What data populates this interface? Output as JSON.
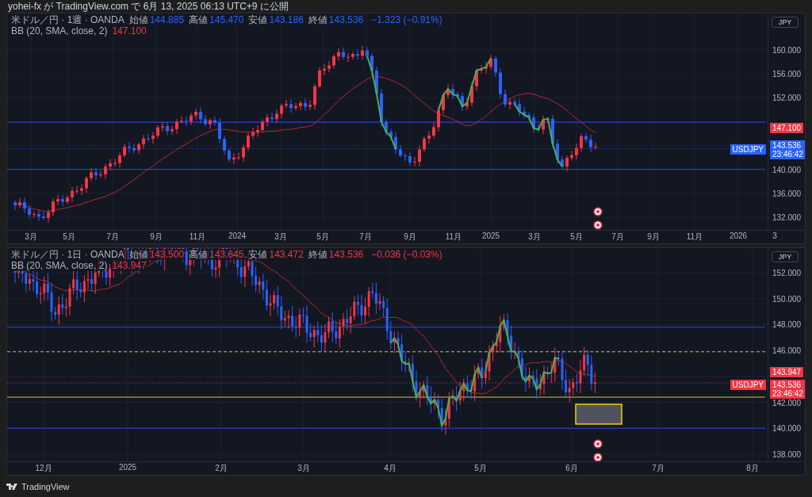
{
  "header": {
    "text": "yohei-fx が TradingView.com で 6月 13, 2025 06:13 UTC+9 に公開"
  },
  "panels": [
    {
      "currency": "JPY",
      "symbol": "米ドル／円 · 1週 · OANDA",
      "up_bar": false,
      "ohlc": [
        {
          "label": "始値",
          "value": "144.885"
        },
        {
          "label": "高値",
          "value": "145.470"
        },
        {
          "label": "安値",
          "value": "143.186"
        },
        {
          "label": "終値",
          "value": "143.536"
        }
      ],
      "change": "−1.323 (−0.91%)",
      "bb": {
        "label": "BB (20, SMA, close, 2)",
        "value": "147.100"
      },
      "price_ticks": [
        "160.000",
        "156.000",
        "152.000",
        "140.000",
        "136.000",
        "132.000"
      ],
      "price_labels": [
        {
          "kind": "price",
          "text": "147.100",
          "color": "#f23645"
        },
        {
          "kind": "symbol",
          "text": "USDJPY",
          "color": "#2962ff"
        },
        {
          "kind": "price",
          "text": "143.536",
          "sub": "23:46:42",
          "color": "#2962ff"
        }
      ],
      "time_ticks": [
        "3月",
        "5月",
        "7月",
        "9月",
        "11月",
        "2024",
        "3月",
        "5月",
        "7月",
        "9月",
        "11月",
        "2025",
        "3月",
        "5月",
        "7月",
        "9月",
        "11月",
        "2026",
        "3"
      ]
    },
    {
      "currency": "JPY",
      "symbol": "米ドル／円 · 1日 · OANDA",
      "up_bar": true,
      "ohlc": [
        {
          "label": "始値",
          "value": "143.500"
        },
        {
          "label": "高値",
          "value": "143.645"
        },
        {
          "label": "安値",
          "value": "143.472"
        },
        {
          "label": "終値",
          "value": "143.536"
        }
      ],
      "change": "−0.036 (−0.03%)",
      "bb": {
        "label": "BB (20, SMA, close, 2)",
        "value": "143.947"
      },
      "price_ticks": [
        "152.000",
        "150.000",
        "148.000",
        "146.000",
        "142.000",
        "140.000",
        "138.000"
      ],
      "price_labels": [
        {
          "kind": "price",
          "text": "143.947",
          "color": "#f23645"
        },
        {
          "kind": "symbol",
          "text": "USDJPY",
          "color": "#f23645"
        },
        {
          "kind": "price",
          "text": "143.536",
          "sub": "23:46:42",
          "color": "#f23645"
        }
      ],
      "time_ticks": [
        "12月",
        "2025",
        "2月",
        "3月",
        "4月",
        "5月",
        "6月",
        "7月",
        "8月"
      ]
    }
  ],
  "footer": {
    "brand": "TradingView"
  }
}
